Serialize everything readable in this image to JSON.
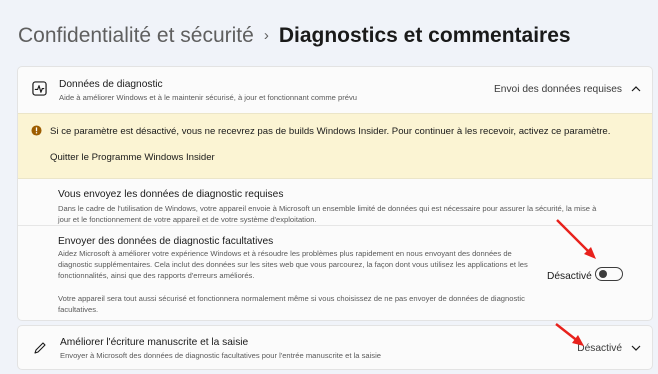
{
  "header": {
    "breadcrumb_parent": "Confidentialité et sécurité",
    "separator": "›",
    "current_page": "Diagnostics et commentaires"
  },
  "diagnostic_data": {
    "icon": "diagnostic-chart-icon",
    "title": "Données de diagnostic",
    "subtitle": "Aide à améliorer Windows et à le maintenir sécurisé, à jour et fonctionnant comme prévu",
    "status": "Envoi des données requises",
    "expanded": true
  },
  "warning": {
    "icon": "warning-info-icon",
    "text": "Si ce paramètre est désactivé, vous ne recevrez pas de builds Windows Insider. Pour continuer à les recevoir, activez ce paramètre.",
    "link": "Quitter le Programme Windows Insider"
  },
  "required_data": {
    "title": "Vous envoyez les données de diagnostic requises",
    "description": "Dans le cadre de l'utilisation de Windows, votre appareil envoie à Microsoft un ensemble limité de données qui est nécessaire pour assurer la sécurité, la mise à jour et le fonctionnement de votre appareil et de votre système d'exploitation."
  },
  "optional_data": {
    "title": "Envoyer des données de diagnostic facultatives",
    "description": "Aidez Microsoft à améliorer votre expérience Windows et à résoudre les problèmes plus rapidement en nous envoyant des données de diagnostic supplémentaires. Cela inclut des données sur les sites web que vous parcourez, la façon dont vous utilisez les applications et les fonctionnalités, ainsi que des rapports d'erreurs améliorés.",
    "note": "Votre appareil sera tout aussi sécurisé et fonctionnera normalement même si vous choisissez de ne pas envoyer de données de diagnostic facultatives.",
    "status": "Désactivé",
    "toggle_on": false
  },
  "handwriting": {
    "icon": "pen-icon",
    "title": "Améliorer l'écriture manuscrite et la saisie",
    "subtitle": "Envoyer à Microsoft des données de diagnostic facultatives pour l'entrée manuscrite et la saisie",
    "status": "Désactivé",
    "expanded": false
  },
  "annotations": {
    "arrow_color": "#e8211c"
  }
}
